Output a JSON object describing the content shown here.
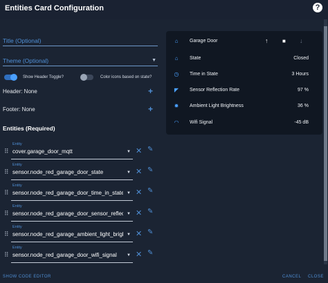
{
  "dialog": {
    "title": "Entities Card Configuration",
    "help_icon": "help-circle-icon"
  },
  "form": {
    "title_placeholder": "Title (Optional)",
    "theme_placeholder": "Theme (Optional)",
    "show_header_toggle_label": "Show Header Toggle?",
    "show_header_toggle_on": true,
    "state_color_label": "Color icons based on state?",
    "state_color_on": false,
    "header_label": "Header: None",
    "footer_label": "Footer: None",
    "entities_heading": "Entities (Required)"
  },
  "entities": [
    {
      "label": "Entity",
      "value": "cover.garage_door_mqtt"
    },
    {
      "label": "Entity",
      "value": "sensor.node_red_garage_door_state"
    },
    {
      "label": "Entity",
      "value": "sensor.node_red_garage_door_time_in_state"
    },
    {
      "label": "Entity",
      "value": "sensor.node_red_garage_door_sensor_reflec"
    },
    {
      "label": "Entity",
      "value": "sensor.node_red_garage_ambient_light_brigl"
    },
    {
      "label": "Entity",
      "value": "sensor.node_red_garage_door_wifi_signal"
    }
  ],
  "preview": {
    "rows": [
      {
        "name": "Garage Door",
        "value": "",
        "icon": "garage-icon"
      },
      {
        "name": "State",
        "value": "Closed",
        "icon": "garage-icon"
      },
      {
        "name": "Time in State",
        "value": "3 Hours",
        "icon": "timer-icon"
      },
      {
        "name": "Sensor Reflection Rate",
        "value": "97 %",
        "icon": "reflection-icon"
      },
      {
        "name": "Ambient Light Brightness",
        "value": "36 %",
        "icon": "brightness-icon"
      },
      {
        "name": "Wifi Signal",
        "value": "-45 dB",
        "icon": "wifi-icon"
      }
    ],
    "controls": {
      "up": "↑",
      "stop": "■",
      "down": "↓"
    }
  },
  "footer": {
    "show_code_editor": "SHOW CODE EDITOR",
    "cancel": "CANCEL",
    "close": "CLOSE"
  },
  "colors": {
    "accent": "#4f8fd6",
    "background": "#1b2433",
    "card": "#101722"
  }
}
